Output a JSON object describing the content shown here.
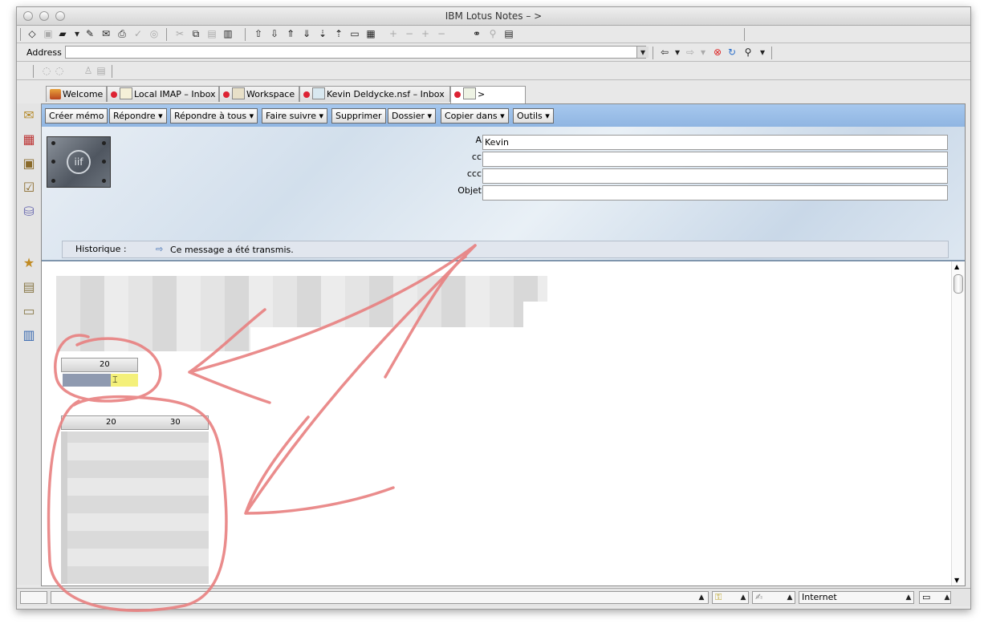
{
  "window": {
    "title": "IBM Lotus Notes – >"
  },
  "address_bar": {
    "label": "Address",
    "value": ""
  },
  "tabs": [
    {
      "label": "Welcome",
      "icon": "home-icon"
    },
    {
      "label": "Local IMAP – Inbox",
      "icon": "mailbox-icon"
    },
    {
      "label": "Workspace",
      "icon": "workspace-icon"
    },
    {
      "label": "Kevin Deldycke.nsf – Inbox",
      "icon": "database-icon"
    },
    {
      "label": ">",
      "icon": "document-icon"
    }
  ],
  "actions": [
    {
      "label": "Créer mémo"
    },
    {
      "label": "Répondre ▾"
    },
    {
      "label": "Répondre à tous ▾"
    },
    {
      "label": "Faire suivre ▾"
    },
    {
      "label": "Supprimer"
    },
    {
      "label": "Dossier ▾"
    },
    {
      "label": "Copier dans ▾"
    },
    {
      "label": "Outils ▾"
    }
  ],
  "memo": {
    "to_label": "A",
    "to_value": "Kevin",
    "cc_label": "cc",
    "cc_value": "",
    "bcc_label": "ccc",
    "bcc_value": "",
    "subject_label": "Objet",
    "subject_value": "",
    "history_label": "Historique :",
    "history_text": "Ce message a été transmis."
  },
  "rulers": {
    "small": {
      "tick": "20"
    },
    "large": {
      "tick1": "20",
      "tick2": "30"
    }
  },
  "status": {
    "location": "Internet"
  },
  "colors": {
    "action_bar": "#9dbfe8",
    "annotation": "#e88080"
  }
}
